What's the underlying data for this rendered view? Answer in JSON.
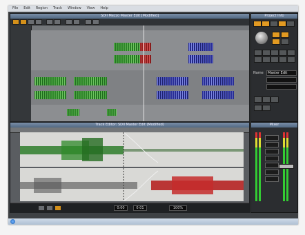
{
  "menubar": {
    "items": [
      "File",
      "Edit",
      "Region",
      "Track",
      "Window",
      "View",
      "Help"
    ]
  },
  "top_window": {
    "title": "SDII Mezzo Master Edit [Modified]"
  },
  "editor_window": {
    "title": "Track Editor: SDII Master Edit (Modified)"
  },
  "side_panel": {
    "title": "Project Info",
    "field_label": "Name",
    "field_value": "Master Edit"
  },
  "mixer_panel": {
    "title": "Mixer"
  },
  "transport": {
    "position": "0:00",
    "length": "0:01",
    "zoom": "100%"
  },
  "colors": {
    "accent": "#e29a22",
    "clip_green": "#4aa63d",
    "clip_blue": "#4a54c8",
    "clip_red": "#c42c2c"
  },
  "icons": [
    "windows-start-icon",
    "knob-icon",
    "play-icon",
    "stop-icon",
    "record-icon"
  ]
}
